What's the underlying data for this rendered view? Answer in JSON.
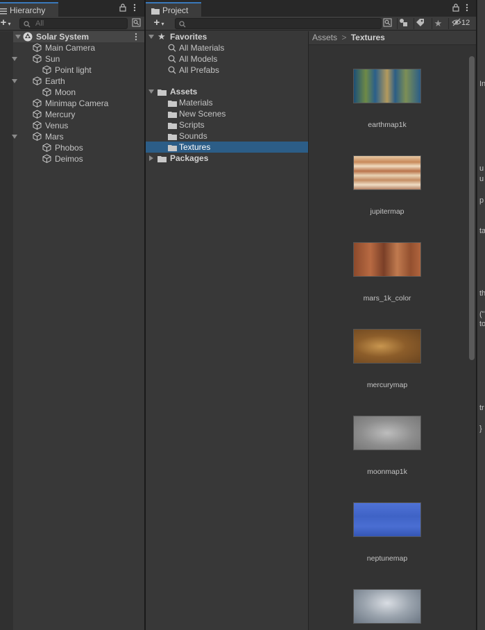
{
  "hierarchy": {
    "tab_label": "Hierarchy",
    "search_placeholder": "All",
    "add_label": "+",
    "scene_name": "Solar System",
    "objects": [
      {
        "label": "Main Camera"
      },
      {
        "label": "Sun"
      },
      {
        "label": "Point light"
      },
      {
        "label": "Earth"
      },
      {
        "label": "Moon"
      },
      {
        "label": "Minimap Camera"
      },
      {
        "label": "Mercury"
      },
      {
        "label": "Venus"
      },
      {
        "label": "Mars"
      },
      {
        "label": "Phobos"
      },
      {
        "label": "Deimos"
      }
    ]
  },
  "project": {
    "tab_label": "Project",
    "add_label": "+",
    "hidden_count": "12",
    "favorites": {
      "label": "Favorites",
      "items": [
        "All Materials",
        "All Models",
        "All Prefabs"
      ]
    },
    "assets": {
      "label": "Assets",
      "folders": [
        "Materials",
        "New Scenes",
        "Scripts",
        "Sounds",
        "Textures"
      ]
    },
    "packages_label": "Packages",
    "breadcrumb": {
      "root": "Assets",
      "separator": ">",
      "current": "Textures"
    },
    "textures": [
      {
        "name": "earthmap1k"
      },
      {
        "name": "jupitermap"
      },
      {
        "name": "mars_1k_color"
      },
      {
        "name": "mercurymap"
      },
      {
        "name": "moonmap1k"
      },
      {
        "name": "neptunemap"
      },
      {
        "name": ""
      }
    ]
  },
  "inspector_fragments": [
    "In",
    "u",
    "u",
    "p",
    "ta",
    "th",
    "(\"",
    "to",
    "tr",
    "}"
  ],
  "colors": {
    "selection": "#2c5d87",
    "panel": "#383838",
    "tab_accent": "#3a79bb"
  }
}
